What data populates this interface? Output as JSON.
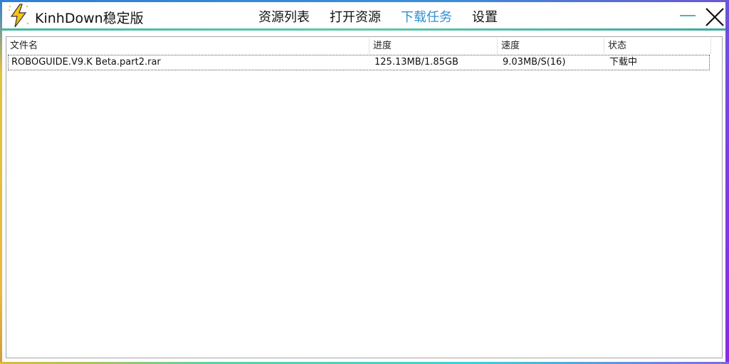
{
  "app": {
    "title": "KinhDown稳定版"
  },
  "nav": {
    "items": [
      {
        "label": "资源列表"
      },
      {
        "label": "打开资源"
      },
      {
        "label": "下载任务"
      },
      {
        "label": "设置"
      }
    ],
    "active_index": 2
  },
  "table": {
    "columns": [
      "文件名",
      "进度",
      "速度",
      "状态"
    ],
    "rows": [
      {
        "filename": "ROBOGUIDE.V9.K Beta.part2.rar",
        "progress": "125.13MB/1.85GB",
        "speed": "9.03MB/S(16)",
        "status": "下载中"
      }
    ]
  },
  "colors": {
    "accent": "#2e8fd4",
    "minimize": "#45b8c2",
    "separator": "#3eb9a0"
  },
  "icons": {
    "logo": "lightning-bolt-icon",
    "minimize": "minimize-icon",
    "close": "close-icon"
  }
}
